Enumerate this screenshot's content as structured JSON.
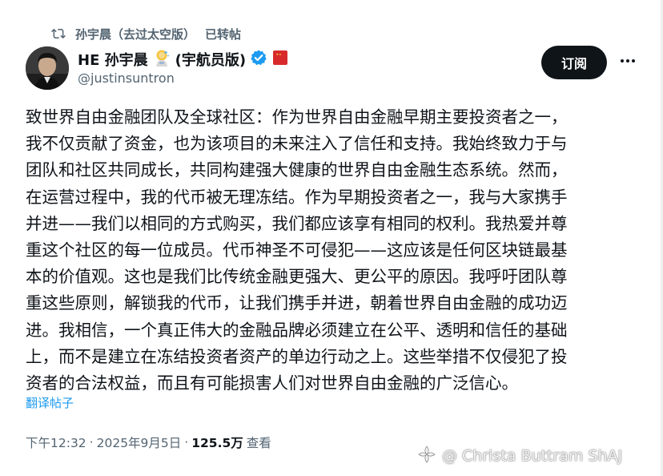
{
  "repost": {
    "reposter": "孙宇晨（去过太空版）",
    "label": "已转帖"
  },
  "author": {
    "display_name": "HE 孙宇晨",
    "name_suffix": "(宇航员版)",
    "handle": "@justinsuntron",
    "verified": true
  },
  "actions": {
    "subscribe_label": "订阅",
    "more_icon": "more-horizontal-icon"
  },
  "post": {
    "lines": [
      "致世界自由金融团队及全球社区：作为世界自由金融早期主要投资者之一，",
      "我不仅贡献了资金，也为该项目的未来注入了信任和支持。我始终致力于与",
      "团队和社区共同成长，共同构建强大健康的世界自由金融生态系统。然而，",
      "在运营过程中，我的代币被无理冻结。作为早期投资者之一，我与大家携手",
      "并进——我们以相同的方式购买，我们都应该享有相同的权利。我热爱并尊",
      "重这个社区的每一位成员。代币神圣不可侵犯——这应该是任何区块链最基",
      "本的价值观。这也是我们比传统金融更强大、更公平的原因。我呼吁团队尊",
      "重这些原则，解锁我的代币，让我们携手并进，朝着世界自由金融的成功迈",
      "进。我相信，一个真正伟大的金融品牌必须建立在公平、透明和信任的基础",
      "上，而不是建立在冻结投资者资产的单边行动之上。这些举措不仅侵犯了投",
      "资者的合法权益，而且有可能损害人们对世界自由金融的广泛信心。"
    ],
    "translate_label": "翻译帖子"
  },
  "meta": {
    "time": "下午12:32",
    "separator": "·",
    "date": "2025年9月5日",
    "views": "125.5万",
    "views_label": "查看"
  },
  "watermark": {
    "text": "@ Christa Buttram ShAJ"
  },
  "colors": {
    "text": "#0f1419",
    "muted": "#536471",
    "link": "#1d9bf0",
    "verified_badge": "#1d9bf0",
    "subscribe_bg": "#0f1419",
    "flag_red": "#d82a2a"
  }
}
